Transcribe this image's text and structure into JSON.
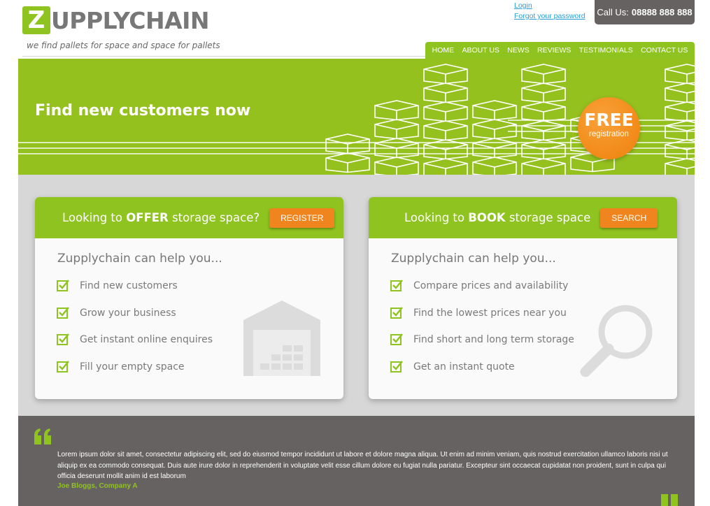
{
  "brand": {
    "logo_letter": "Z",
    "logo_rest": "UPPLYCHAIN",
    "tagline": "we find pallets for space and space for pallets",
    "accent_color": "#8fc31f",
    "cta_color": "#f0841e",
    "dark_color": "#666262"
  },
  "top_links": {
    "login": "Login",
    "forgot": "Forgot your password"
  },
  "call": {
    "label": "Call Us:",
    "number": "08888 888 888"
  },
  "nav": [
    "HOME",
    "ABOUT US",
    "NEWS",
    "REVIEWS",
    "TESTIMONIALS",
    "CONTACT US"
  ],
  "hero": {
    "title": "Find new customers now",
    "badge_big": "FREE",
    "badge_small": "registration"
  },
  "offer_card": {
    "heading_pre": "Looking to ",
    "heading_bold": "OFFER",
    "heading_post": " storage space?",
    "button": "REGISTER",
    "subtitle": "Zupplychain can help you...",
    "items": [
      "Find new customers",
      "Grow your business",
      "Get instant online enquires",
      "Fill your empty space"
    ],
    "illustration_icon": "warehouse-icon"
  },
  "book_card": {
    "heading_pre": "Looking to ",
    "heading_bold": "BOOK",
    "heading_post": " storage space",
    "button": "SEARCH",
    "subtitle": "Zupplychain can help you...",
    "items": [
      "Compare prices and availability",
      "Find the lowest prices near you",
      "Find short and long term storage",
      "Get an instant quote"
    ],
    "illustration_icon": "magnifier-icon"
  },
  "testimonial": {
    "text": "Lorem ipsum dolor sit amet, consectetur adipiscing elit, sed do eiusmod tempor incididunt ut labore et dolore magna aliqua. Ut enim ad minim veniam, quis nostrud exercitation ullamco laboris nisi ut aliquip ex ea commodo consequat. Duis aute irure dolor in reprehenderit in voluptate velit esse cillum dolore eu fugiat nulla pariatur. Excepteur sint occaecat cupidatat non proident, sunt in culpa qui officia deserunt mollit anim id est laborum",
    "author": "Joe Bloggs, Company A"
  }
}
